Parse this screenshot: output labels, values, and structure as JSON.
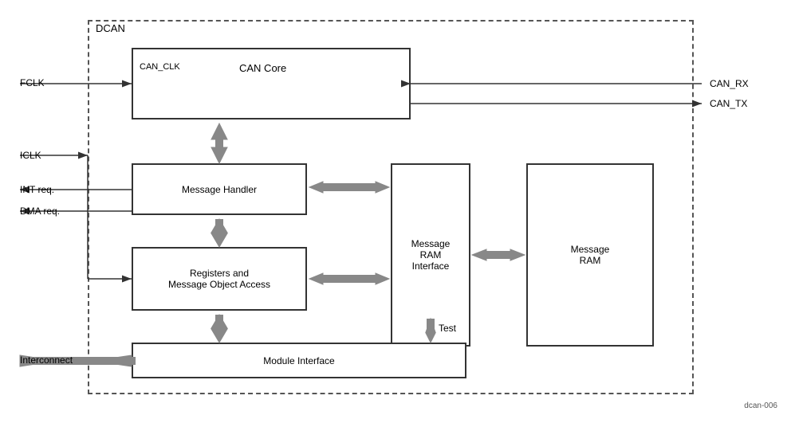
{
  "diagram": {
    "title": "DCAN",
    "diagram_number": "dcan-006",
    "labels": {
      "dcan": "DCAN",
      "can_clk": "CAN_CLK",
      "can_core": "CAN Core",
      "message_handler": "Message Handler",
      "registers": "Registers and\nMessage Object Access",
      "msg_ram_interface": "Message\nRAM\nInterface",
      "msg_ram": "Message\nRAM",
      "module_interface": "Module Interface",
      "fclk": "FCLK",
      "iclk": "ICLK",
      "int_req": "INT req.",
      "dma_req": "DMA req.",
      "interconnect": "Interconnect",
      "can_rx": "CAN_RX",
      "can_tx": "CAN_TX",
      "test": "Test"
    }
  }
}
